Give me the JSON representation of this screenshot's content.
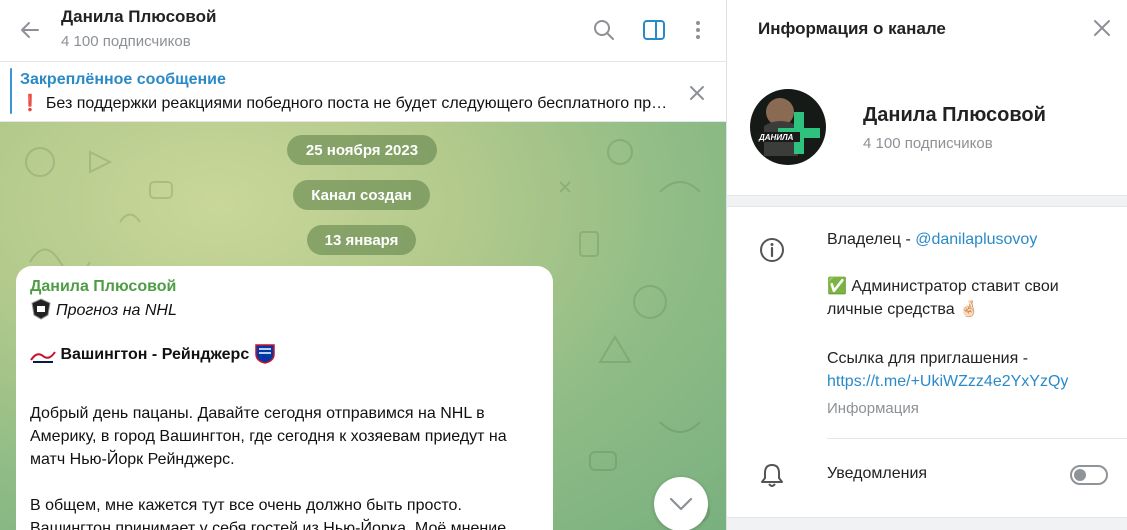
{
  "chat": {
    "title": "Данила Плюсовой",
    "subscribers": "4 100 подписчиков",
    "pinned": {
      "title": "Закреплённое сообщение",
      "mark": "❗",
      "text": "Без поддержки реакциями победного поста не будет следующего бесплатного прогноза"
    },
    "dates": [
      "25 ноября 2023",
      "Канал создан",
      "13 января"
    ],
    "message": {
      "author": "Данила Плюсовой",
      "subtitle": "Прогноз на NHL",
      "matchup": "Вашингтон - Рейнджерс",
      "para1": "Добрый день пацаны. Давайте сегодня отправимся на NHL в Америку, в город Вашингтон, где сегодня к хозяевам приедут на матч Нью-Йорк Рейнджерс.",
      "para2_line1": "В общем, мне кажется тут все очень должно быть просто.",
      "para2_line2": "Вашингтон принимает у себя гостей из Нью-Йорка. Моё мнение"
    }
  },
  "info": {
    "header": "Информация о канале",
    "name": "Данила Плюсовой",
    "subscribers": "4 100 подписчиков",
    "owner_label": "Владелец - ",
    "owner_handle": "@danilaplusovoy",
    "admin_mark": "✅",
    "admin_text": "Администратор ставит свои личные средства 🤞🏻",
    "invite_label": "Ссылка для приглашения -",
    "invite_link": "https://t.me/+UkiWZzz4e2YxYzQy",
    "info_caption": "Информация",
    "notifications_label": "Уведомления",
    "notifications_on": false,
    "avatar_text": "ДАНИЛА"
  },
  "colors": {
    "accent": "#2a8ac8",
    "author": "#4e9d46",
    "chat_bg": "#9cc48a"
  }
}
